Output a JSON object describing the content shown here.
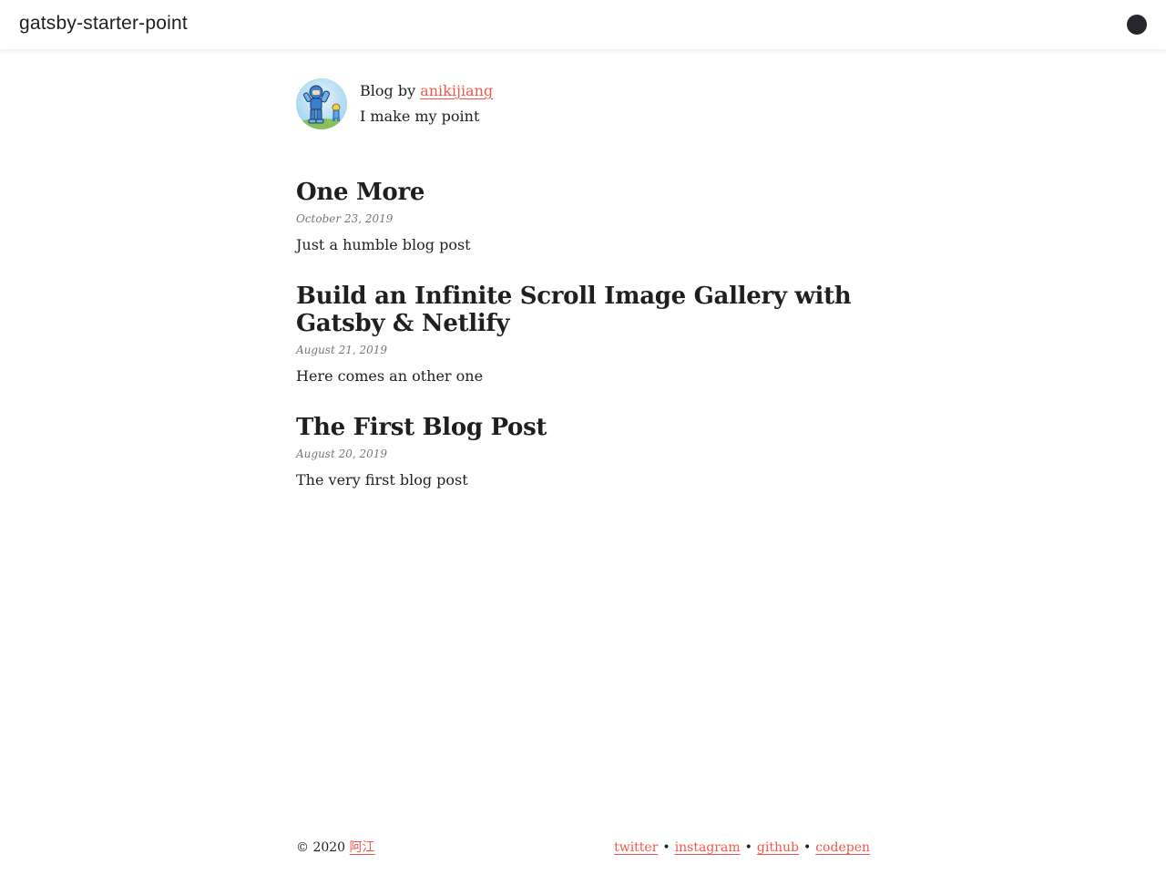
{
  "header": {
    "site_title": "gatsby-starter-point",
    "theme_toggle_color": "#25272d"
  },
  "bio": {
    "prefix": "Blog by ",
    "author": "anikijiang",
    "tagline": "I make my point",
    "avatar_icon": "robot-character-avatar"
  },
  "posts": [
    {
      "title": "One More",
      "date": "October 23, 2019",
      "description": "Just a humble blog post"
    },
    {
      "title": "Build an Infinite Scroll Image Gallery with Gatsby & Netlify",
      "date": "August 21, 2019",
      "description": "Here comes an other one"
    },
    {
      "title": "The First Blog Post",
      "date": "August 20, 2019",
      "description": "The very first blog post"
    }
  ],
  "footer": {
    "copyright": "© 2020 ",
    "owner": "阿江",
    "links": [
      "twitter",
      "instagram",
      "github",
      "codepen"
    ],
    "separator": "•"
  },
  "colors": {
    "accent": "#f0574b",
    "text": "#1f1f1f",
    "muted": "#777777"
  }
}
